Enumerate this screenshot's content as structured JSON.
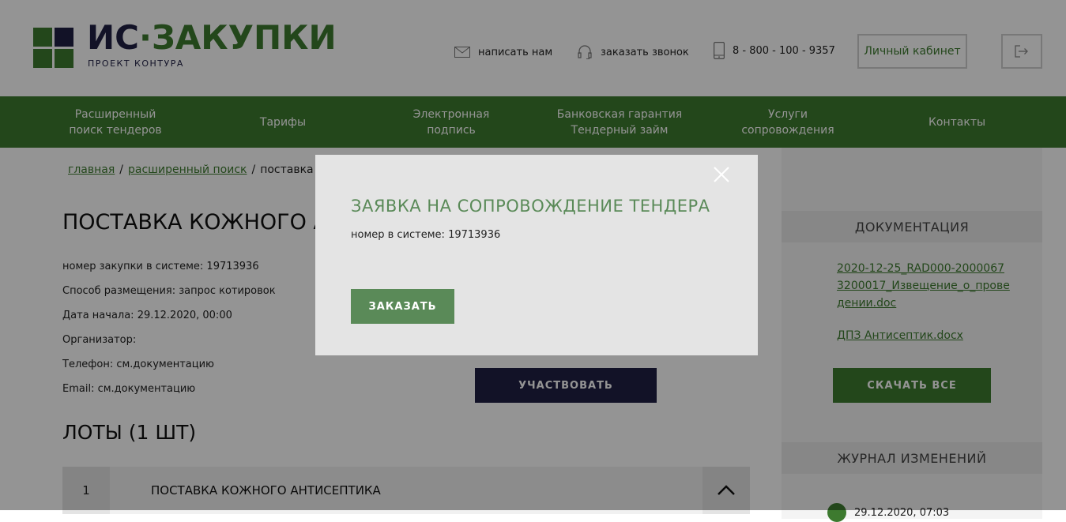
{
  "header": {
    "logo_main_is": "ИС",
    "logo_main_dot": "·",
    "logo_main_zak": "ЗАКУПКИ",
    "logo_sub": "ПРОЕКТ КОНТУРА",
    "write_us": "написать нам",
    "order_call": "заказать звонок",
    "phone": "8 - 800 - 100 - 9357",
    "cabinet": "Личный кабинет"
  },
  "nav": [
    {
      "line1": "Расширенный",
      "line2": "поиск тендеров"
    },
    {
      "line1": "Тарифы",
      "line2": ""
    },
    {
      "line1": "Электронная",
      "line2": "подпись"
    },
    {
      "line1": "Банковская гарантия",
      "line2": "Тендерный займ"
    },
    {
      "line1": "Услуги",
      "line2": "сопровождения"
    },
    {
      "line1": "Контакты",
      "line2": ""
    }
  ],
  "breadcrumb": {
    "home": "главная",
    "search": "расширенный поиск",
    "sep": "/",
    "current": "поставка кожного антисептика"
  },
  "tender": {
    "title": "ПОСТАВКА КОЖНОГО АНТИСЕПТИКА",
    "number": "номер закупки в системе: 19713936",
    "method": "Способ размещения: запрос котировок",
    "start": "Дата начала: 29.12.2020, 00:00",
    "organizer": "Организатор:",
    "phone": "Телефон: см.документацию",
    "email": "Email: см.документацию",
    "participate": "УЧАСТВОВАТЬ"
  },
  "lots": {
    "title": "ЛОТЫ (1 ШТ)",
    "items": [
      {
        "num": "1",
        "name": "ПОСТАВКА КОЖНОГО АНТИСЕПТИКА"
      }
    ]
  },
  "sidebar": {
    "documentation": "ДОКУМЕНТАЦИЯ",
    "docs": [
      "2020-12-25_RAD000-20000673200017_Извещение_о_проведении.doc",
      "ДПЗ Антисептик.docx"
    ],
    "download_all": "СКАЧАТЬ ВСЕ",
    "changelog": "ЖУРНАЛ ИЗМЕНЕНИЙ",
    "log_date": "29.12.2020, 07:03"
  },
  "modal": {
    "title": "ЗАЯВКА НА СОПРОВОЖДЕНИЕ ТЕНДЕРА",
    "subtitle": "номер в системе: 19713936",
    "order": "ЗАКАЗАТЬ"
  },
  "colors": {
    "brand_green": "#3d7a2f",
    "brand_navy": "#1f1f44",
    "modal_green": "#5a8a58"
  }
}
